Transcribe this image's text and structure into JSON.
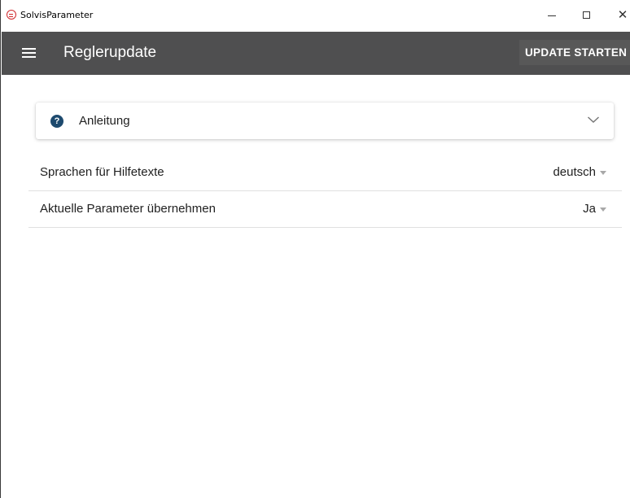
{
  "window": {
    "title": "SolvisParameter",
    "app_icon": "solvis-app-icon",
    "controls": [
      "minimize-icon",
      "maximize-icon",
      "close-icon"
    ]
  },
  "appbar": {
    "menu_icon": "hamburger-menu-icon",
    "title": "Reglerupdate",
    "action_label": "UPDATE STARTEN",
    "background": "#4f4f50"
  },
  "help_card": {
    "icon": "help-circle-icon",
    "title": "Anleitung",
    "expand_icon": "chevron-down-icon",
    "icon_color": "#1d4a6e"
  },
  "settings": [
    {
      "label": "Sprachen für Hilfetexte",
      "value": "deutsch"
    },
    {
      "label": "Aktuelle Parameter übernehmen",
      "value": "Ja"
    }
  ]
}
